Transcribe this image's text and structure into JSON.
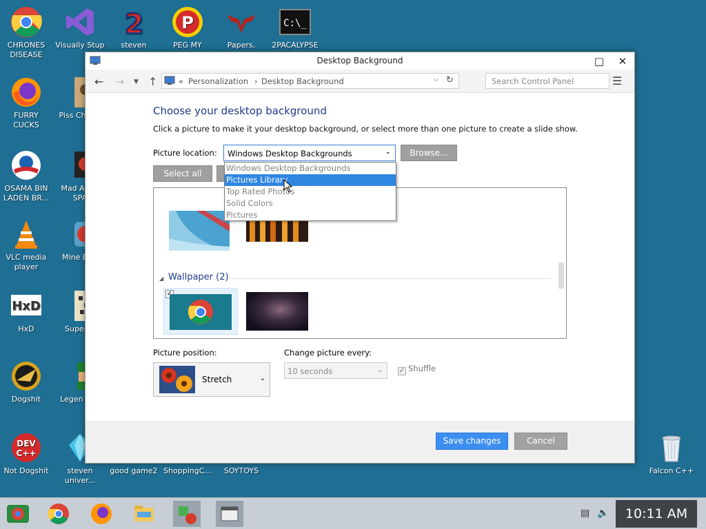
{
  "desktop": {
    "icons": [
      {
        "label": "CHRONES DISEASE",
        "icon": "chrome-icon"
      },
      {
        "label": "Visually Stup",
        "icon": "visual-studio-icon"
      },
      {
        "label": "steven",
        "icon": "steven-icon"
      },
      {
        "label": "PEG MY WIFE!",
        "icon": "peggle-icon"
      },
      {
        "label": "Papers,",
        "icon": "papers-icon"
      },
      {
        "label": "2PACALYPSE",
        "icon": "cmd-icon"
      },
      {
        "label": "FURRY CUCKS",
        "icon": "firefox-icon"
      },
      {
        "label": "Piss Chicke",
        "icon": "game-icon"
      },
      {
        "label": "OSAMA BIN LADEN BR...",
        "icon": "obama-icon"
      },
      {
        "label": "Mad Av IN SPA",
        "icon": "angry-birds-space-icon"
      },
      {
        "label": "VLC media player",
        "icon": "vlc-icon"
      },
      {
        "label": "Mine Bird",
        "icon": "angry-birds-icon"
      },
      {
        "label": "HxD",
        "icon": "hxd-icon"
      },
      {
        "label": "Super H",
        "icon": "pixel-game-icon"
      },
      {
        "label": "Dogshit",
        "icon": "dogshit-icon"
      },
      {
        "label": "Legen Zild",
        "icon": "zelda-icon"
      },
      {
        "label": "Not Dogshit",
        "icon": "devcpp-icon"
      },
      {
        "label": "steven univer...",
        "icon": "gem-icon"
      },
      {
        "label": "good game2",
        "icon": "blank-icon"
      },
      {
        "label": "ShoppingC...",
        "icon": "blank-icon"
      },
      {
        "label": "SOYTOYS",
        "icon": "blank-icon"
      },
      {
        "label": "Falcon C++",
        "icon": "recycle-bin-icon"
      }
    ]
  },
  "window": {
    "title": "Desktop Background",
    "breadcrumb_prefix": "«",
    "breadcrumb_1": "Personalization",
    "breadcrumb_sep": "›",
    "breadcrumb_2": "Desktop Background",
    "search_placeholder": "Search Control Panel",
    "heading": "Choose your desktop background",
    "subtitle": "Click a picture to make it your desktop background, or select more than one picture to create a slide show.",
    "picture_location_label": "Picture location:",
    "picture_location_value": "Windows Desktop Backgrounds",
    "browse_label": "Browse...",
    "select_all_label": "Select all",
    "dropdown_options": [
      "Windows Desktop Backgrounds",
      "Pictures Library",
      "Top Rated Photos",
      "Solid Colors",
      "Pictures"
    ],
    "dropdown_highlighted": "Pictures Library",
    "group_header": "Wallpaper (2)",
    "picture_position_label": "Picture position:",
    "picture_position_value": "Stretch",
    "change_every_label": "Change picture every:",
    "change_every_value": "10 seconds",
    "shuffle_label": "Shuffle",
    "save_label": "Save changes",
    "cancel_label": "Cancel"
  },
  "taskbar": {
    "clock": "10:11 AM",
    "apps": [
      "start-icon",
      "chrome-icon",
      "firefox-icon",
      "file-explorer-icon",
      "control-panel-icon",
      "window-app-icon"
    ]
  },
  "colors": {
    "desktop_bg": "#1f6e93",
    "accent": "#2f86e0",
    "heading": "#1d3b8c",
    "save_button": "#3c8ef0"
  }
}
